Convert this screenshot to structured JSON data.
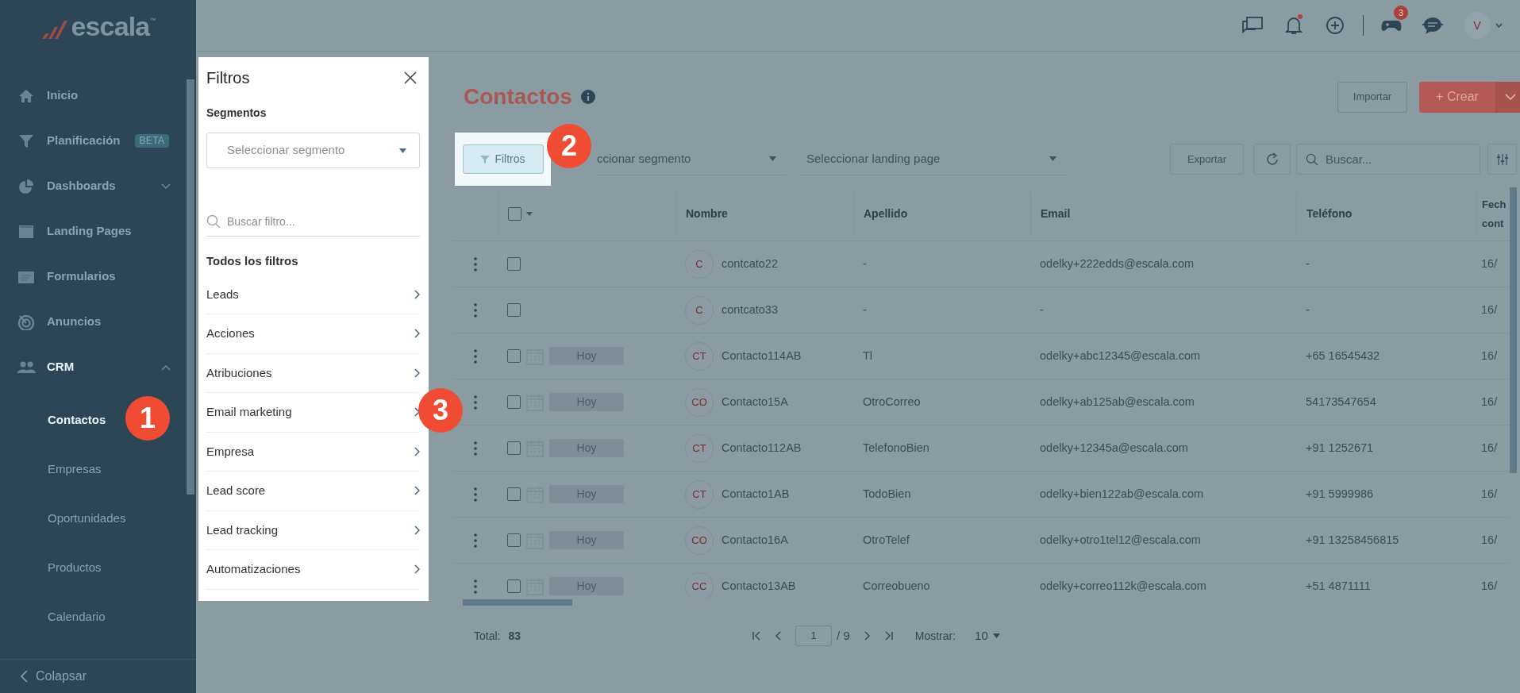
{
  "logo": {
    "text": "escala",
    "mark": "™"
  },
  "sidebar": {
    "items": [
      {
        "label": "Inicio",
        "selected": false
      },
      {
        "label": "Planificación",
        "badge": "BETA",
        "selected": false
      },
      {
        "label": "Dashboards",
        "expanded": false,
        "selected": false
      },
      {
        "label": "Landing Pages",
        "selected": false
      },
      {
        "label": "Formularios",
        "selected": false
      },
      {
        "label": "Anuncios",
        "selected": false
      },
      {
        "label": "CRM",
        "expanded": true,
        "selected": true,
        "children": [
          {
            "label": "Contactos",
            "selected": true
          },
          {
            "label": "Empresas",
            "selected": false
          },
          {
            "label": "Oportunidades",
            "selected": false
          },
          {
            "label": "Productos",
            "selected": false
          },
          {
            "label": "Calendario",
            "selected": false
          }
        ]
      }
    ],
    "collapse": "Colapsar"
  },
  "topbar": {
    "notification_dot": true,
    "badge": "3",
    "avatar": "V"
  },
  "filters_panel": {
    "title": "Filtros",
    "segment_label": "Segmentos",
    "segment_placeholder": "Seleccionar segmento",
    "search_placeholder": "Buscar filtro...",
    "section_title": "Todos los filtros",
    "items": [
      "Leads",
      "Acciones",
      "Atribuciones",
      "Email marketing",
      "Empresa",
      "Lead score",
      "Lead tracking",
      "Automatizaciones"
    ]
  },
  "page": {
    "title": "Contactos",
    "import_button": "Importar",
    "create_button": "+ Crear"
  },
  "toolbar": {
    "filters_button": "Filtros",
    "segment_select": "ccionar segmento",
    "landing_select": "Seleccionar landing page",
    "export_button": "Exportar",
    "search_placeholder": "Buscar..."
  },
  "table": {
    "select_all_checked": false,
    "columns": [
      "Nombre",
      "Apellido",
      "Email",
      "Teléfono",
      "Fech cont"
    ],
    "rows": [
      {
        "checked": false,
        "initials": "C",
        "name": "contcato22",
        "surname": "-",
        "email": "odelky+222edds@escala.com",
        "phone": "-",
        "date": "16/"
      },
      {
        "checked": false,
        "initials": "C",
        "name": "contcato33",
        "surname": "-",
        "email": "-",
        "phone": "-",
        "date": "16/"
      },
      {
        "checked": false,
        "due": "Hoy",
        "initials": "CT",
        "name": "Contacto114AB",
        "surname": "Tl",
        "email": "odelky+abc12345@escala.com",
        "phone": "+65 16545432",
        "date": "16/"
      },
      {
        "checked": false,
        "due": "Hoy",
        "initials": "CO",
        "name": "Contacto15A",
        "surname": "OtroCorreo",
        "email": "odelky+ab125ab@escala.com",
        "phone": "54173547654",
        "date": "16/"
      },
      {
        "checked": false,
        "due": "Hoy",
        "initials": "CT",
        "name": "Contacto112AB",
        "surname": "TelefonoBien",
        "email": "odelky+12345a@escala.com",
        "phone": "+91 1252671",
        "date": "16/"
      },
      {
        "checked": false,
        "due": "Hoy",
        "initials": "CT",
        "name": "Contacto1AB",
        "surname": "TodoBien",
        "email": "odelky+bien122ab@escala.com",
        "phone": "+91 5999986",
        "date": "16/"
      },
      {
        "checked": false,
        "due": "Hoy",
        "initials": "CO",
        "name": "Contacto16A",
        "surname": "OtroTelef",
        "email": "odelky+otro1tel12@escala.com",
        "phone": "+91 13258456815",
        "date": "16/"
      },
      {
        "checked": false,
        "due": "Hoy",
        "initials": "CC",
        "name": "Contacto13AB",
        "surname": "Correobueno",
        "email": "odelky+correo112k@escala.com",
        "phone": "+51 4871111",
        "date": "16/"
      }
    ]
  },
  "footer": {
    "total_label": "Total:",
    "total": "83",
    "page": "1",
    "pages": "/ 9",
    "show_label": "Mostrar:",
    "page_size": "10"
  },
  "callouts": [
    "1",
    "2",
    "3"
  ]
}
